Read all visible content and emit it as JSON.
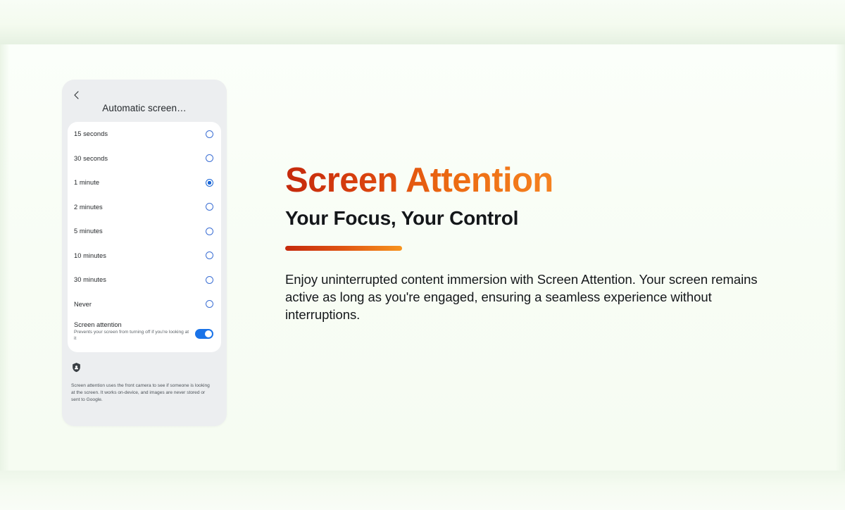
{
  "phone": {
    "back_icon": "chevron-left-icon",
    "title": "Automatic screen…",
    "timeout_options": [
      {
        "label": "15 seconds",
        "selected": false
      },
      {
        "label": "30 seconds",
        "selected": false
      },
      {
        "label": "1 minute",
        "selected": true
      },
      {
        "label": "2 minutes",
        "selected": false
      },
      {
        "label": "5 minutes",
        "selected": false
      },
      {
        "label": "10 minutes",
        "selected": false
      },
      {
        "label": "30 minutes",
        "selected": false
      },
      {
        "label": "Never",
        "selected": false
      }
    ],
    "screen_attention": {
      "title": "Screen attention",
      "description": "Prevents your screen from turning off if you're looking at it",
      "toggle_state": "on",
      "toggle_color": "#1a73e8"
    },
    "info": {
      "icon": "shield-privacy-icon",
      "text": "Screen attention uses the front camera to see if someone is looking at the screen. It works on-device, and images are never stored or sent to Google."
    },
    "colors": {
      "header_bg": "#eceef0",
      "card_bg": "#ffffff",
      "radio_accent": "#1a66d6"
    }
  },
  "content": {
    "headline": "Screen Attention",
    "subheadline": "Your Focus, Your Control",
    "body": "Enjoy uninterrupted content immersion with Screen Attention. Your screen remains active as long as you're engaged, ensuring a seamless experience without interruptions.",
    "accent_gradient_start": "#c4290c",
    "accent_gradient_end": "#f7941e"
  },
  "background": {
    "base_color": "#f6fcf3",
    "band_color": "#e6f1e2"
  }
}
